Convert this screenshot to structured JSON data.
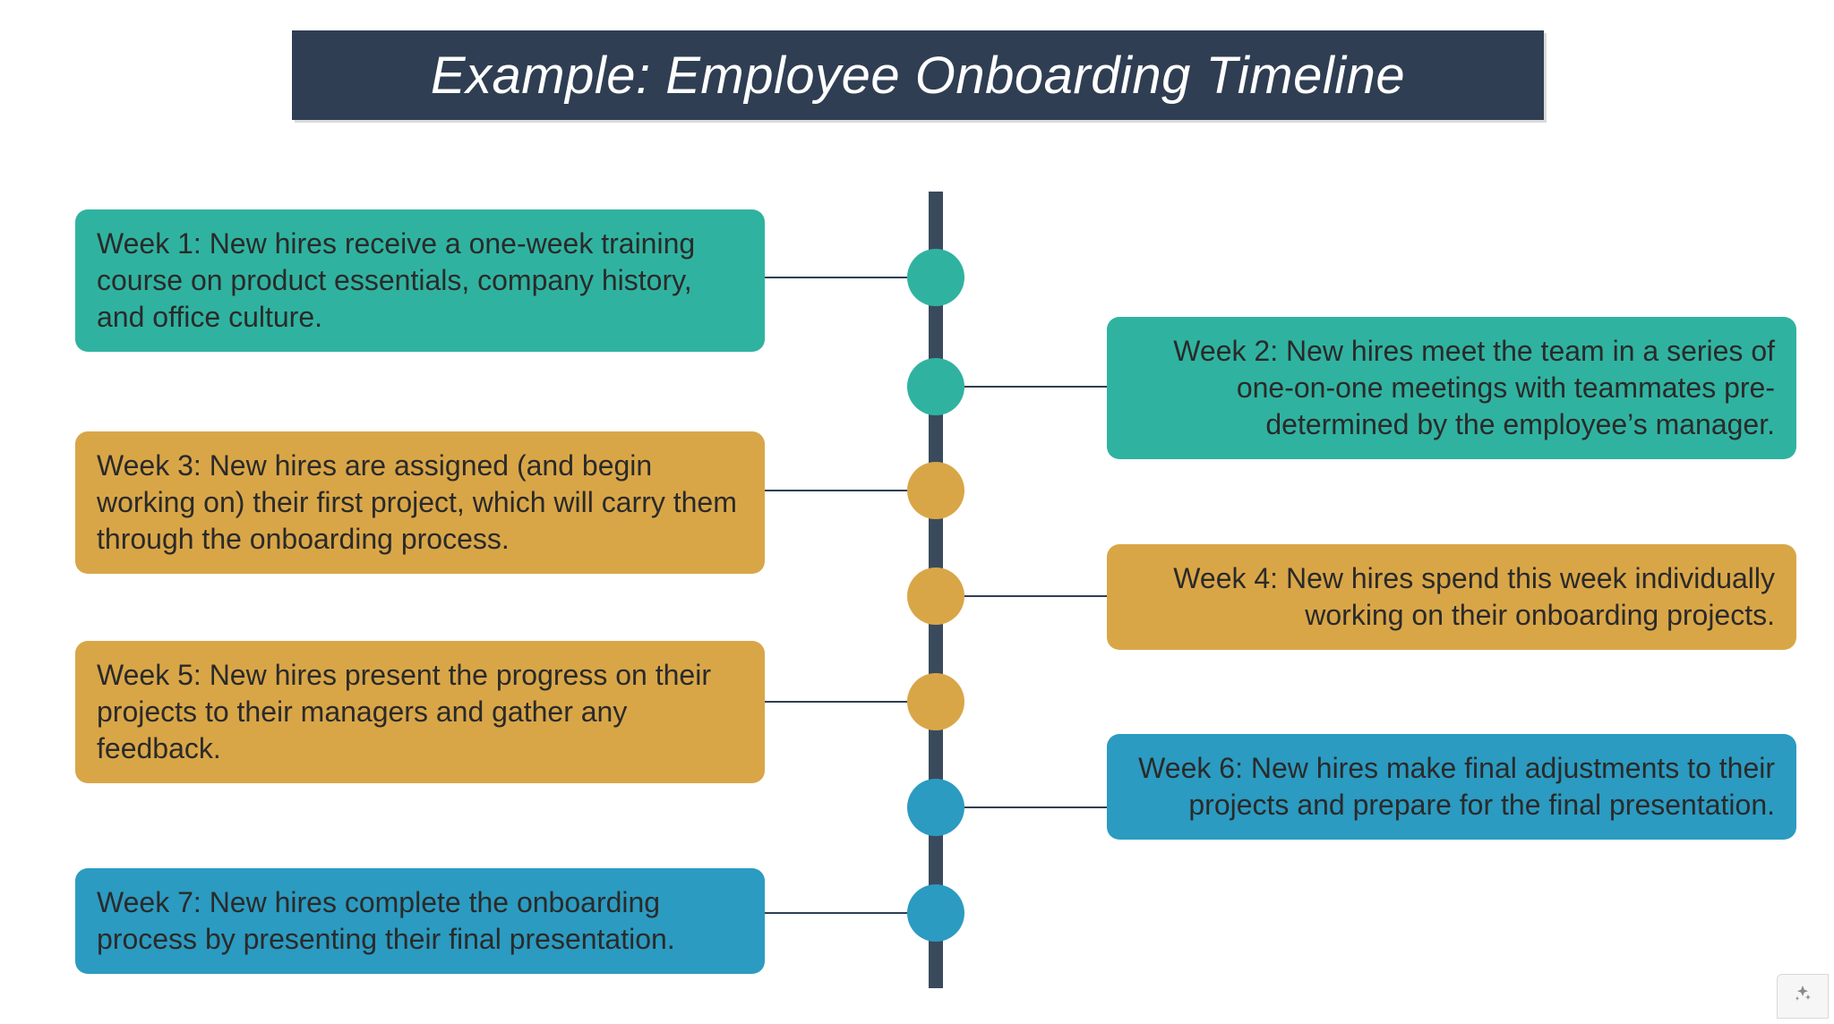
{
  "title": "Example: Employee Onboarding Timeline",
  "colors": {
    "teal": "#2fb3a0",
    "gold": "#d9a647",
    "blue": "#2b9bc1",
    "rail": "#3a4a5d",
    "titlebg": "#2f3e52"
  },
  "timeline": [
    {
      "side": "left",
      "color": "teal",
      "text": "Week 1: New hires receive a one-week training course on product essentials, company history, and office culture."
    },
    {
      "side": "right",
      "color": "teal",
      "text": "Week 2: New hires meet the team in a series of one-on-one meetings with teammates pre-determined by the employee’s manager."
    },
    {
      "side": "left",
      "color": "gold",
      "text": "Week 3: New hires are assigned (and begin working on) their first project, which will carry them through the onboarding process."
    },
    {
      "side": "right",
      "color": "gold",
      "text": "Week 4: New hires spend this week individually working on their onboarding projects."
    },
    {
      "side": "left",
      "color": "gold",
      "text": "Week 5: New hires present the progress on their projects to their managers and gather any feedback."
    },
    {
      "side": "right",
      "color": "blue",
      "text": "Week 6: New hires make final adjustments to their projects and prepare for the final presentation."
    },
    {
      "side": "left",
      "color": "blue",
      "text": "Week 7: New hires complete the onboarding process by presenting their final presentation."
    }
  ]
}
